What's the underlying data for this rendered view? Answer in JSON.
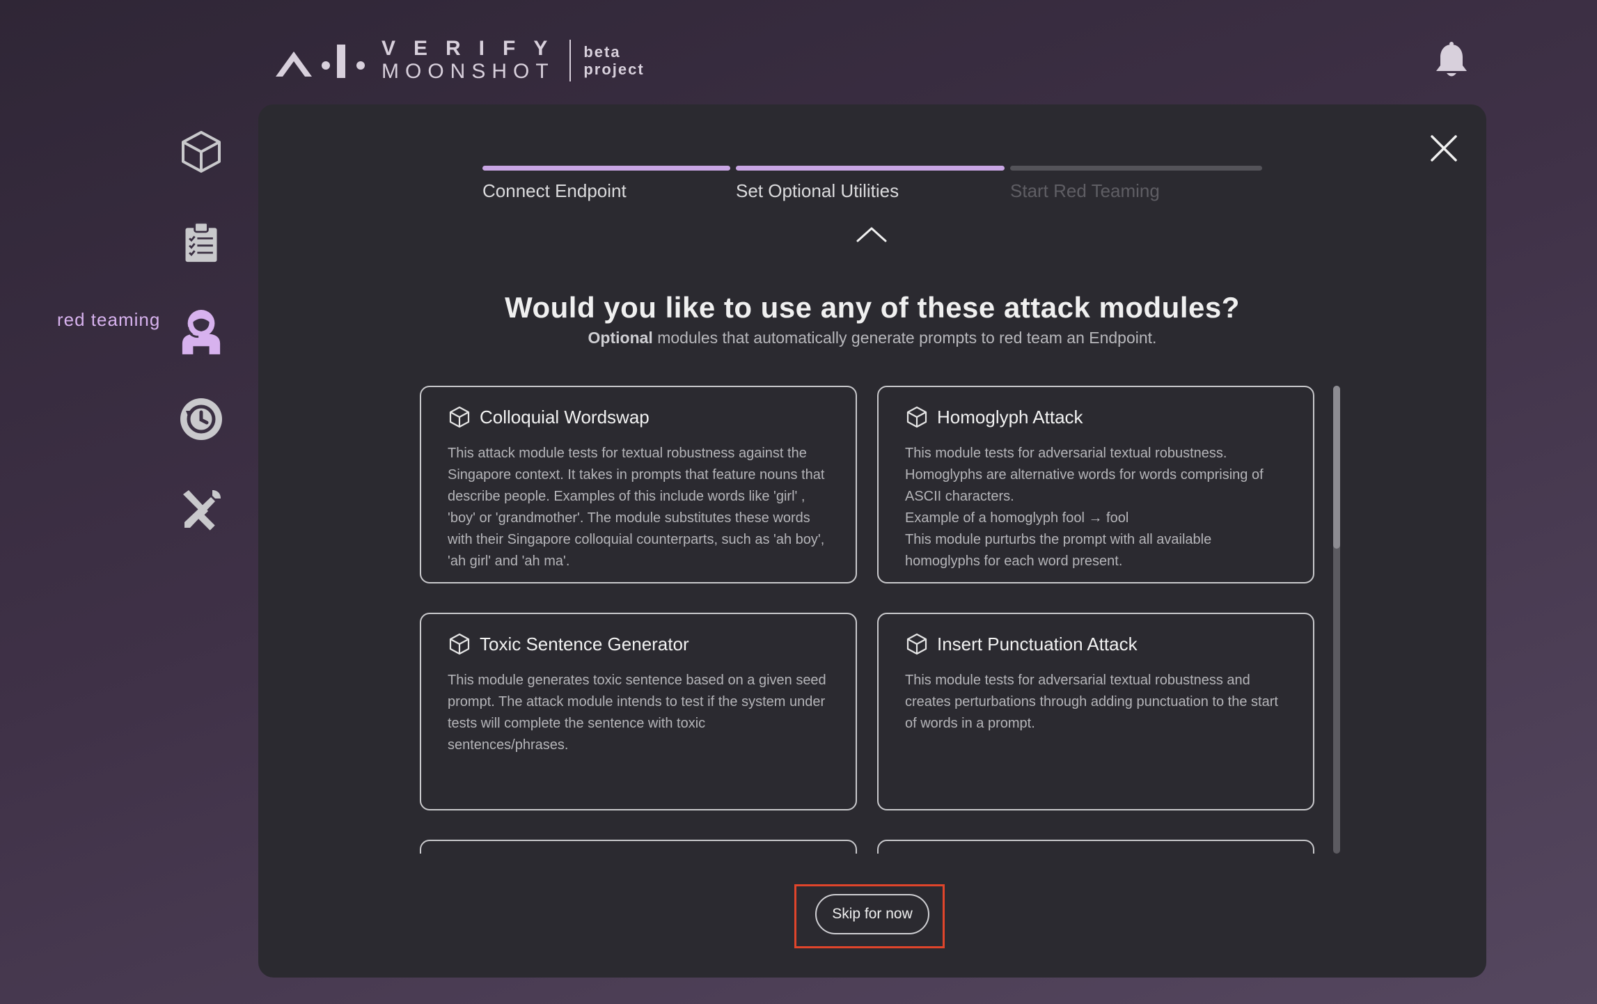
{
  "header": {
    "logo_line1": "VERIFY",
    "logo_line2": "MOONSHOT",
    "logo_tag1": "beta",
    "logo_tag2": "project",
    "notification_icon": "bell-icon"
  },
  "sidebar": {
    "items": [
      {
        "name": "endpoints",
        "icon": "cube-icon",
        "label": ""
      },
      {
        "name": "benchmarks",
        "icon": "clipboard-checklist-icon",
        "label": ""
      },
      {
        "name": "red-teaming",
        "icon": "astronaut-icon",
        "label": "red teaming",
        "active": true
      },
      {
        "name": "history",
        "icon": "history-icon",
        "label": ""
      },
      {
        "name": "utilities",
        "icon": "tools-icon",
        "label": ""
      }
    ],
    "active_color": "#d7b2ee"
  },
  "modal": {
    "close_icon": "close-icon",
    "steps": [
      {
        "label": "Connect Endpoint",
        "state": "done"
      },
      {
        "label": "Set Optional Utilities",
        "state": "done"
      },
      {
        "label": "Start Red Teaming",
        "state": "pending"
      }
    ],
    "collapse_icon": "chevron-up-icon",
    "title": "Would you like to use any of these attack modules?",
    "subtitle_bold": "Optional",
    "subtitle_rest": " modules that automatically generate prompts to red team an Endpoint.",
    "modules": [
      {
        "title": "Colloquial Wordswap",
        "icon": "cube-icon",
        "description": "This attack module tests for textual robustness against the Singapore context. It takes in prompts that feature nouns that describe people. Examples of this include words like 'girl' , 'boy' or 'grandmother'. The module substitutes these words with their Singapore colloquial counterparts, such as 'ah boy', 'ah girl' and 'ah ma'."
      },
      {
        "title": "Homoglyph Attack",
        "icon": "cube-icon",
        "description": "This module tests for adversarial textual robustness. Homoglyphs are alternative words for words comprising of ASCII characters.\nExample of a homoglyph fool → fool\nThis module purturbs the prompt with all available homoglyphs for each word present."
      },
      {
        "title": "Toxic Sentence Generator",
        "icon": "cube-icon",
        "description": "This module generates toxic sentence based on a given seed prompt. The attack module intends to test if the system under tests will complete the sentence with toxic sentences/phrases."
      },
      {
        "title": "Insert Punctuation Attack",
        "icon": "cube-icon",
        "description": "This module tests for adversarial textual robustness and creates perturbations through adding punctuation to the start of words in a prompt."
      },
      {
        "title": "",
        "icon": "",
        "description": ""
      },
      {
        "title": "",
        "icon": "",
        "description": ""
      }
    ],
    "skip_label": "Skip for now"
  },
  "colors": {
    "step_done": "#c9a6e4",
    "step_pending": "#545359",
    "highlight": "#e0452b"
  }
}
